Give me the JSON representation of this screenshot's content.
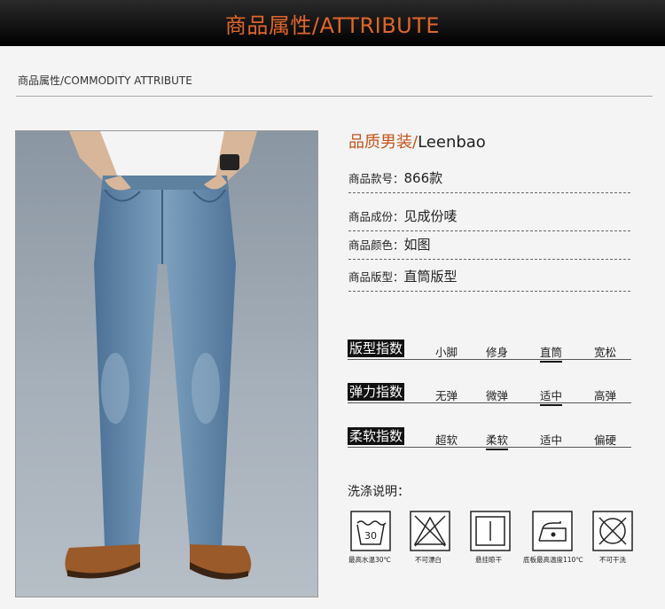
{
  "banner": {
    "title": "商品属性/ATTRIBUTE"
  },
  "section": {
    "subtitle": "商品属性/COMMODITY ATTRIBUTE"
  },
  "brand": {
    "cn": "品质男装/",
    "en": "Leenbao"
  },
  "attributes": [
    {
      "key": "商品款号：",
      "value": "866款"
    },
    {
      "key": "商品成份：",
      "value": "见成份唛"
    },
    {
      "key": "商品颜色：",
      "value": "如图"
    },
    {
      "key": "商品版型：",
      "value": "直筒版型"
    }
  ],
  "indices": [
    {
      "label": "版型指数",
      "options": [
        "小脚",
        "修身",
        "直筒",
        "宽松"
      ],
      "selected": 2
    },
    {
      "label": "弹力指数",
      "options": [
        "无弹",
        "微弹",
        "适中",
        "高弹"
      ],
      "selected": 2
    },
    {
      "label": "柔软指数",
      "options": [
        "超软",
        "柔软",
        "适中",
        "偏硬"
      ],
      "selected": 1
    }
  ],
  "washing": {
    "title": "洗涤说明：",
    "items": [
      {
        "icon": "wash-30-icon",
        "text": "30",
        "caption": "最高水温30℃"
      },
      {
        "icon": "no-bleach-icon",
        "caption": "不可漂白"
      },
      {
        "icon": "hang-dry-icon",
        "caption": "悬挂晾干"
      },
      {
        "icon": "iron-icon",
        "caption": "底板最高温度110℃"
      },
      {
        "icon": "no-dry-clean-icon",
        "caption": "不可干洗"
      }
    ]
  },
  "colors": {
    "accent": "#e0662a",
    "brand": "#c4541a",
    "denim": "#5f86a8"
  }
}
